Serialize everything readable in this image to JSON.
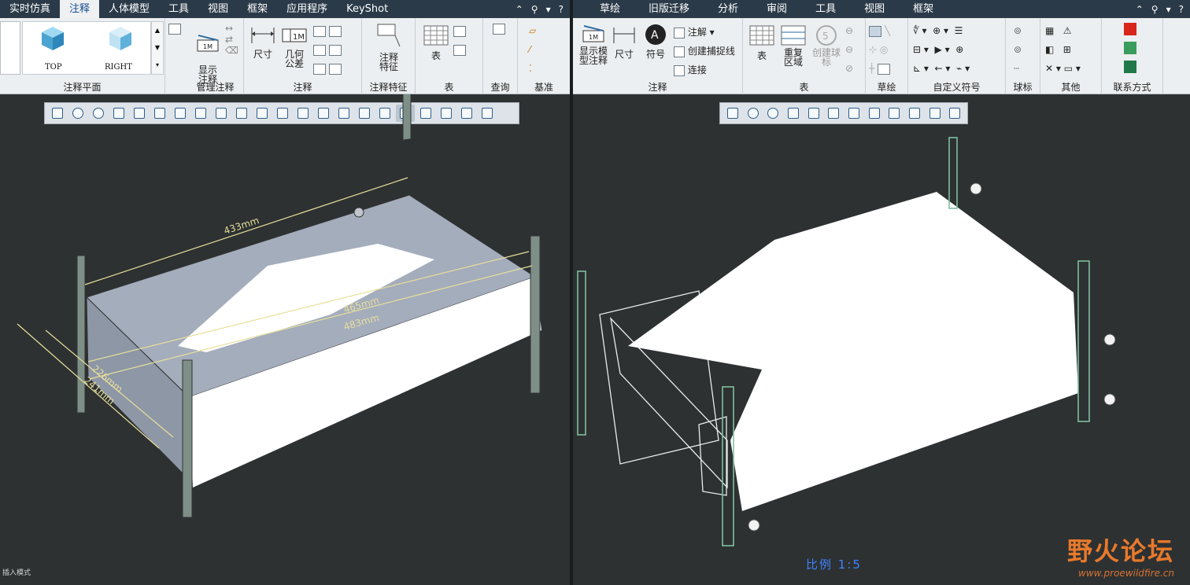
{
  "left": {
    "tabs": [
      "实时仿真",
      "注释",
      "人体模型",
      "工具",
      "视图",
      "框架",
      "应用程序",
      "KeyShot"
    ],
    "active_tab": "注释",
    "planes": {
      "top": "TOP",
      "right": "RIGHT"
    },
    "groups": {
      "annot_plane": "注释平面",
      "manage": "管理注释",
      "annot": "注释",
      "feature": "注释特征",
      "table": "表",
      "query": "查询",
      "datum": "基准"
    },
    "buttons": {
      "show_annot": "显示\n注释",
      "dimension": "尺寸",
      "gtol": "几何\n公差",
      "annot_feature": "注释\n特征",
      "table": "表"
    },
    "dims": {
      "d1": "433mm",
      "d2": "465mm",
      "d3": "483mm",
      "d4": "226mm",
      "d5": "241mm"
    },
    "status": "插入模式"
  },
  "right": {
    "tabs": [
      "草绘",
      "旧版迁移",
      "分析",
      "审阅",
      "工具",
      "视图",
      "框架"
    ],
    "groups": {
      "annot": "注释",
      "table": "表",
      "sketch": "草绘",
      "custom_symbol": "自定义符号",
      "balloon": "球标",
      "other": "其他",
      "contact": "联系方式"
    },
    "buttons": {
      "show_model_annot": "显示模\n型注释",
      "dimension": "尺寸",
      "symbol": "符号",
      "note": "注解",
      "snap_line": "创建捕捉线",
      "connect": "连接",
      "table": "表",
      "repeat_region": "重复\n区域",
      "create_balloon": "创建球\n标"
    },
    "scale": "比例 1:5"
  },
  "watermark": {
    "text": "野火论坛",
    "url": "www.proewildfire.cn"
  },
  "colors": {
    "ribbon_tab_bg": "#2b3a48",
    "viewport_bg": "#2d3132",
    "dim_color": "#e8df9a",
    "rack_color": "#7fbf9e",
    "scale_color": "#3f83ff"
  }
}
